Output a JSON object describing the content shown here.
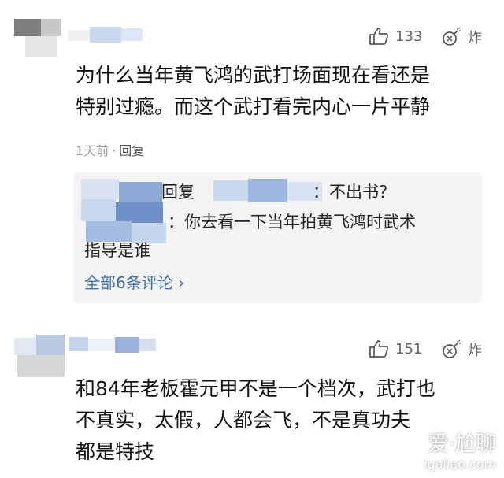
{
  "comments": [
    {
      "likes": "133",
      "bomb_label": "炸",
      "text_lines": [
        "为什么当年黄飞鸿的武打场面现在看还是",
        "特别过瘾。而这个武打看完内心一片平静"
      ],
      "time": "1天前",
      "separator": "·",
      "reply_label": "回复",
      "replies": {
        "line1_suffix": "回复",
        "line1_tail": "：不出书？",
        "line2": "：你去看一下当年拍黄飞鸿时武术",
        "line3": "指导是谁",
        "more": "全部6条评论 ›"
      }
    },
    {
      "likes": "151",
      "bomb_label": "炸",
      "text_lines": [
        "和84年老板霍元甲不是一个档次，武打也",
        "不真实，太假，人都会飞，不是真功夫",
        "都是特技"
      ]
    }
  ],
  "watermark": {
    "title": "爱·尬聊",
    "url": "igaliao.com"
  },
  "colors": {
    "accent_link": "#3a6fb0",
    "muted_text": "#9a9a9a",
    "reply_bg": "#f4f4f4"
  },
  "icons": {
    "like": "thumbs-up-icon",
    "bomb": "bomb-icon"
  }
}
